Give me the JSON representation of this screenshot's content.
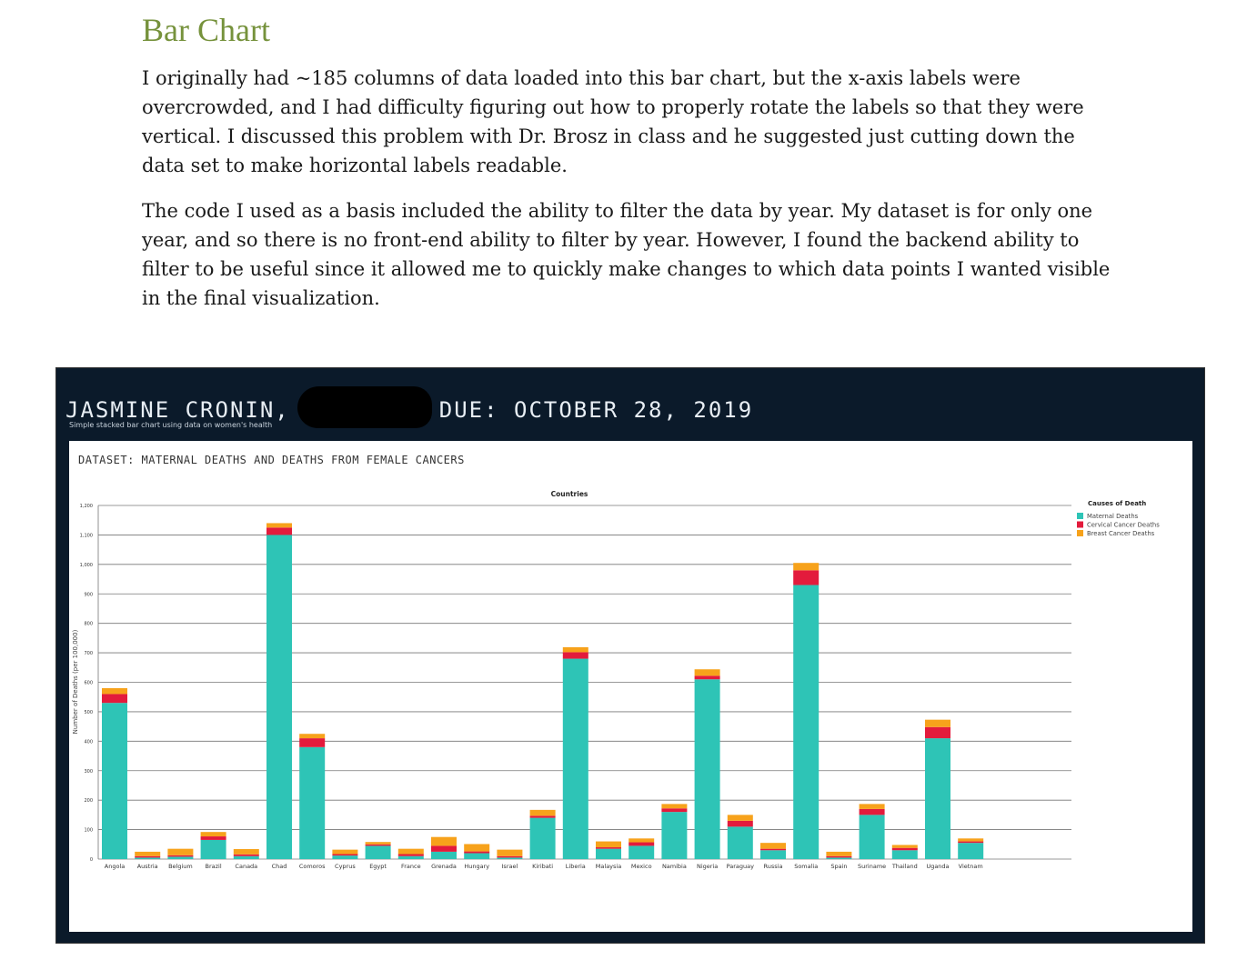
{
  "document": {
    "title": "Bar Chart",
    "paragraph1": "I originally had ~185 columns of data loaded into this bar chart, but the x-axis labels were overcrowded, and I had difficulty figuring out how to properly rotate the labels so that they were vertical. I discussed this problem with Dr. Brosz in class and he suggested just cutting down the data set to make horizontal labels readable.",
    "paragraph2": "The code I used as a basis included the ability to filter the data by year. My dataset is for only one year, and so there is no front-end ability to filter by year. However, I found the backend ability to filter to be useful since it allowed me to quickly make changes to which data points I wanted visible in the final visualization."
  },
  "app": {
    "title_left": "JASMINE CRONIN,",
    "title_right": "DUE: OCTOBER 28, 2019",
    "subtitle": "Simple stacked bar chart using data on women's health",
    "dataset_label": "DATASET: MATERNAL DEATHS AND DEATHS FROM FEMALE CANCERS"
  },
  "colors": {
    "maternal": "#2ec4b6",
    "cervical": "#e31b3c",
    "breast": "#f7a21b",
    "app_bg": "#0b1a2a"
  },
  "chart_data": {
    "type": "bar",
    "stacked": true,
    "title": "Countries",
    "ylabel": "Number of Deaths (per 100,000)",
    "ylim": [
      0,
      1200
    ],
    "yticks": [
      0,
      100,
      200,
      300,
      400,
      500,
      600,
      700,
      800,
      900,
      1000,
      1100,
      1200
    ],
    "grid": true,
    "legend_title": "Causes of Death",
    "legend_position": "top-right",
    "categories": [
      "Angola",
      "Austria",
      "Belgium",
      "Brazil",
      "Canada",
      "Chad",
      "Comoros",
      "Cyprus",
      "Egypt",
      "France",
      "Grenada",
      "Hungary",
      "Israel",
      "Kiribati",
      "Liberia",
      "Malaysia",
      "Mexico",
      "Namibia",
      "Nigeria",
      "Paraguay",
      "Russia",
      "Somalia",
      "Spain",
      "Suriname",
      "Thailand",
      "Uganda",
      "Vietnam"
    ],
    "series": [
      {
        "name": "Maternal Deaths",
        "values": [
          530,
          5,
          8,
          65,
          10,
          1100,
          380,
          12,
          45,
          10,
          25,
          20,
          5,
          140,
          680,
          35,
          45,
          160,
          610,
          110,
          30,
          930,
          5,
          150,
          30,
          410,
          55
        ]
      },
      {
        "name": "Cervical Cancer Deaths",
        "values": [
          30,
          5,
          5,
          12,
          6,
          25,
          30,
          5,
          5,
          7,
          20,
          6,
          5,
          7,
          22,
          5,
          12,
          12,
          12,
          20,
          5,
          50,
          5,
          20,
          8,
          38,
          5
        ]
      },
      {
        "name": "Breast Cancer Deaths",
        "values": [
          20,
          15,
          22,
          15,
          18,
          15,
          15,
          15,
          8,
          18,
          30,
          25,
          22,
          20,
          17,
          20,
          13,
          15,
          22,
          20,
          20,
          25,
          15,
          17,
          10,
          25,
          10
        ]
      }
    ]
  }
}
